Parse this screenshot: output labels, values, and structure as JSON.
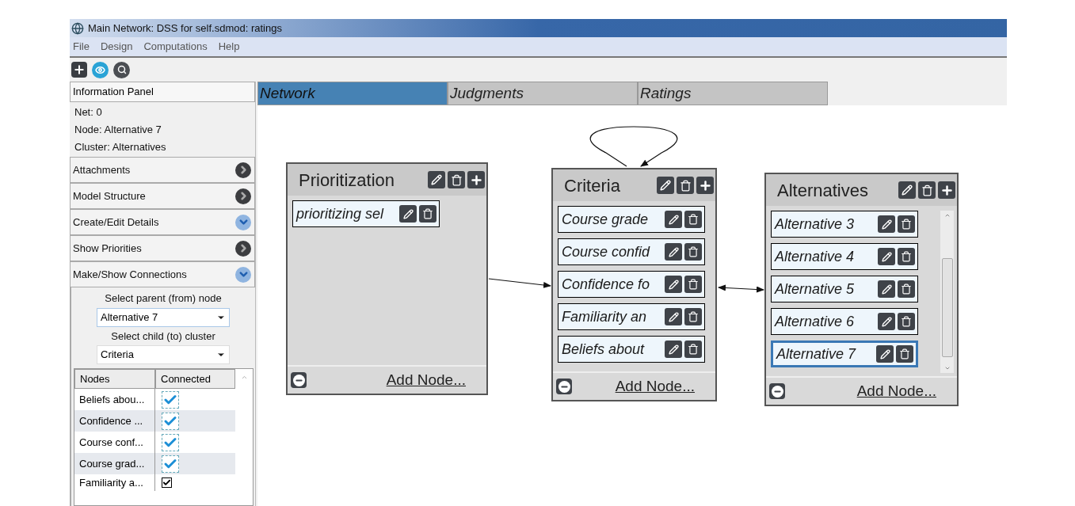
{
  "window": {
    "title": "Main Network: DSS for self.sdmod: ratings"
  },
  "menu": [
    "File",
    "Design",
    "Computations",
    "Help"
  ],
  "toolbar": [
    {
      "kind": "add"
    },
    {
      "kind": "view"
    },
    {
      "kind": "search"
    }
  ],
  "info_panel": {
    "title": "Information Panel",
    "lines": [
      "Net: 0",
      "Node: Alternative 7",
      "Cluster: Alternatives"
    ]
  },
  "sections": [
    {
      "label": "Attachments",
      "expanded": false
    },
    {
      "label": "Model Structure",
      "expanded": false
    },
    {
      "label": "Create/Edit Details",
      "expanded": true
    },
    {
      "label": "Show Priorities",
      "expanded": false
    },
    {
      "label": "Make/Show Connections",
      "expanded": true
    }
  ],
  "connections": {
    "parent_label": "Select parent (from) node",
    "parent_value": "Alternative 7",
    "child_label": "Select child (to) cluster",
    "child_value": "Criteria",
    "table": {
      "columns": [
        "Nodes",
        "Connected"
      ],
      "rows": [
        {
          "node": "Beliefs abou...",
          "connected": true,
          "kind": "styled"
        },
        {
          "node": "Confidence ...",
          "connected": true,
          "kind": "styled"
        },
        {
          "node": "Course conf...",
          "connected": true,
          "kind": "styled"
        },
        {
          "node": "Course grad...",
          "connected": true,
          "kind": "styled"
        },
        {
          "node": "Familiarity a...",
          "connected": true,
          "kind": "plain"
        }
      ]
    }
  },
  "tabs": [
    {
      "label": "Network",
      "selected": true
    },
    {
      "label": "Judgments",
      "selected": false
    },
    {
      "label": "Ratings",
      "selected": false
    }
  ],
  "clusters": [
    {
      "title": "Prioritization",
      "scrollbar": false,
      "add_label": "Add Node...",
      "nodes": [
        {
          "label": "prioritizing sel",
          "selected": false
        }
      ]
    },
    {
      "title": "Criteria",
      "scrollbar": false,
      "add_label": "Add Node...",
      "nodes": [
        {
          "label": "Course grade",
          "selected": false
        },
        {
          "label": "Course confid",
          "selected": false
        },
        {
          "label": "Confidence fo",
          "selected": false
        },
        {
          "label": "Familiarity an",
          "selected": false
        },
        {
          "label": "Beliefs about",
          "selected": false
        }
      ]
    },
    {
      "title": "Alternatives",
      "scrollbar": true,
      "add_label": "Add Node...",
      "nodes": [
        {
          "label": "Alternative 3",
          "selected": false
        },
        {
          "label": "Alternative 4",
          "selected": false
        },
        {
          "label": "Alternative 5",
          "selected": false
        },
        {
          "label": "Alternative 6",
          "selected": false
        },
        {
          "label": "Alternative 7",
          "selected": true
        }
      ]
    }
  ]
}
